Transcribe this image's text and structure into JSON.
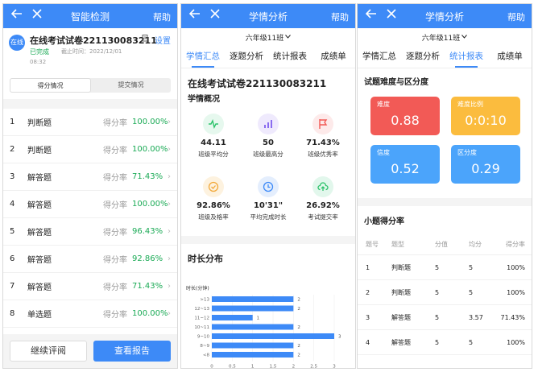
{
  "panel1": {
    "title": "智能检测",
    "help": "帮助",
    "avatar": "在线",
    "exam_name": "在线考试试卷221130083211",
    "settings": "设置",
    "status": "已完成",
    "deadline": "截止时间：2022/12/01",
    "time": "08:32",
    "seg_left": "得分情况",
    "seg_right": "提交情况",
    "rate_label": "得分率",
    "questions": [
      {
        "no": "1",
        "type": "判断题",
        "rate": "100.00%"
      },
      {
        "no": "2",
        "type": "判断题",
        "rate": "100.00%"
      },
      {
        "no": "3",
        "type": "解答题",
        "rate": "71.43%"
      },
      {
        "no": "4",
        "type": "解答题",
        "rate": "100.00%"
      },
      {
        "no": "5",
        "type": "解答题",
        "rate": "96.43%"
      },
      {
        "no": "6",
        "type": "解答题",
        "rate": "92.86%"
      },
      {
        "no": "7",
        "type": "解答题",
        "rate": "71.43%"
      },
      {
        "no": "8",
        "type": "单选题",
        "rate": "100.00%"
      }
    ],
    "btn_continue": "继续评阅",
    "btn_report": "查看报告"
  },
  "panel2": {
    "title": "学情分析",
    "help": "帮助",
    "class": "六年级11班",
    "tabs": [
      "学情汇总",
      "逐题分析",
      "统计报表",
      "成绩单"
    ],
    "exam_name": "在线考试试卷221130083211",
    "sub_title": "学情概况",
    "stats": [
      {
        "value": "44.11",
        "caption": "班级平均分",
        "icon": "pulse-icon",
        "color": "#2cc26a",
        "bg": "#e6f8ee"
      },
      {
        "value": "50",
        "caption": "班级最高分",
        "icon": "bar-chart-icon",
        "color": "#8a6cf0",
        "bg": "#efeafd"
      },
      {
        "value": "71.43%",
        "caption": "班级优秀率",
        "icon": "flag-icon",
        "color": "#f25a56",
        "bg": "#fdeaea"
      },
      {
        "value": "92.86%",
        "caption": "班级及格率",
        "icon": "check-circle-icon",
        "color": "#f2a93b",
        "bg": "#fdf2df"
      },
      {
        "value": "10'31\"",
        "caption": "平均完成时长",
        "icon": "clock-icon",
        "color": "#3d8af7",
        "bg": "#e4eefd"
      },
      {
        "value": "26.92%",
        "caption": "考试提交率",
        "icon": "upload-cloud-icon",
        "color": "#2cc26a",
        "bg": "#e2f7ec"
      }
    ],
    "dist_title": "时长分布"
  },
  "chart_data": {
    "type": "bar",
    "orientation": "horizontal",
    "title": "",
    "ylabel": "时长(分钟)",
    "categories": [
      ">13",
      "12~13",
      "11~12",
      "10~11",
      "9~10",
      "8~9",
      "<8"
    ],
    "values": [
      2,
      2,
      1,
      2,
      3,
      2,
      2
    ],
    "xlim": [
      0,
      3
    ],
    "xticks": [
      "0",
      "0.5",
      "1",
      "1.5",
      "2",
      "2.5",
      "3"
    ],
    "grid": true,
    "color": "#3d8af7"
  },
  "panel3": {
    "title": "学情分析",
    "help": "帮助",
    "class": "六年级11班",
    "tabs": [
      "学情汇总",
      "逐题分析",
      "统计报表",
      "成绩单"
    ],
    "section_title": "试题难度与区分度",
    "cards": [
      {
        "label": "难度",
        "value": "0.88",
        "color": "#f25a56"
      },
      {
        "label": "难度比例",
        "value": "0:0:10",
        "color": "#fbbc3e"
      },
      {
        "label": "信度",
        "value": "0.52",
        "color": "#4ba4fb"
      },
      {
        "label": "区分度",
        "value": "0.29",
        "color": "#4ba4fb"
      }
    ],
    "table_title": "小题得分率",
    "headers": [
      "题号",
      "题型",
      "分值",
      "均分",
      "得分率"
    ],
    "rows": [
      [
        "1",
        "判断题",
        "5",
        "5",
        "100%"
      ],
      [
        "2",
        "判断题",
        "5",
        "5",
        "100%"
      ],
      [
        "3",
        "解答题",
        "5",
        "3.57",
        "71.43%"
      ],
      [
        "4",
        "解答题",
        "5",
        "5",
        "100%"
      ]
    ]
  }
}
